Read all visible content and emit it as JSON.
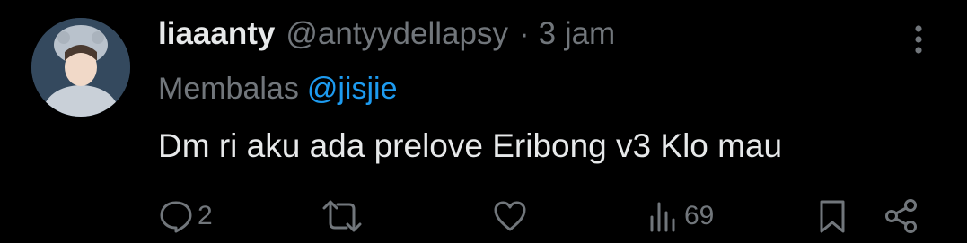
{
  "tweet": {
    "display_name": "liaaanty",
    "handle": "@antyydellapsy",
    "separator": "·",
    "time": "3 jam",
    "reply_label": "Membalas",
    "reply_to": "@jisjie",
    "text": "Dm ri aku ada prelove Eribong v3 Klo mau"
  },
  "actions": {
    "reply_count": "2",
    "views_count": "69"
  },
  "icons": {
    "avatar": "avatar",
    "more": "more-vertical-icon",
    "reply": "reply-icon",
    "repost": "repost-icon",
    "like": "heart-icon",
    "views": "views-icon",
    "bookmark": "bookmark-icon",
    "share": "share-icon"
  },
  "colors": {
    "background": "#000000",
    "primary_text": "#e7e9ea",
    "secondary_text": "#71767b",
    "accent": "#1d9bf0"
  }
}
